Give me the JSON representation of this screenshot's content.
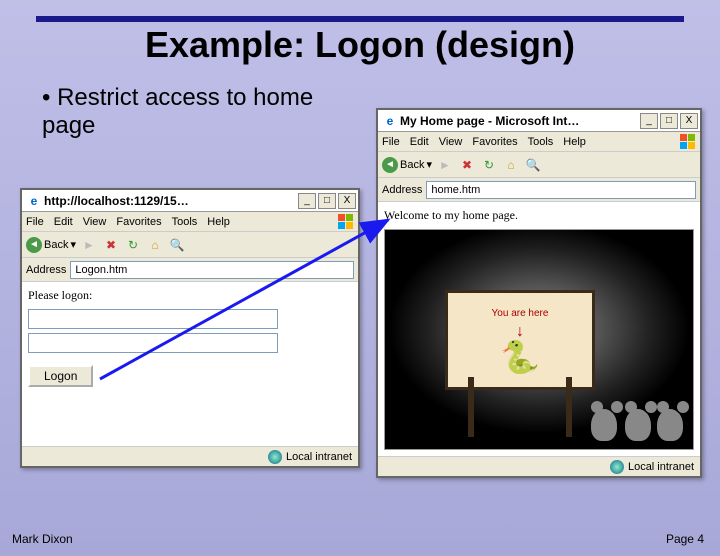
{
  "slide": {
    "title": "Example: Logon (design)",
    "bullet": "Restrict access to home page",
    "footer_author": "Mark Dixon",
    "footer_page": "Page 4"
  },
  "browser_left": {
    "title": "http://localhost:1129/15…",
    "menu": {
      "file": "File",
      "edit": "Edit",
      "view": "View",
      "favorites": "Favorites",
      "tools": "Tools",
      "help": "Help"
    },
    "back_label": "Back",
    "address_label": "Address",
    "address_value": "Logon.htm",
    "content_label": "Please logon:",
    "logon_button": "Logon",
    "status_zone": "Local intranet"
  },
  "browser_right": {
    "title": "My Home page - Microsoft Int…",
    "menu": {
      "file": "File",
      "edit": "Edit",
      "view": "View",
      "favorites": "Favorites",
      "tools": "Tools",
      "help": "Help"
    },
    "back_label": "Back",
    "address_label": "Address",
    "address_value": "home.htm",
    "content_label": "Welcome to my home page.",
    "sign_text": "You are here",
    "status_zone": "Local intranet"
  }
}
